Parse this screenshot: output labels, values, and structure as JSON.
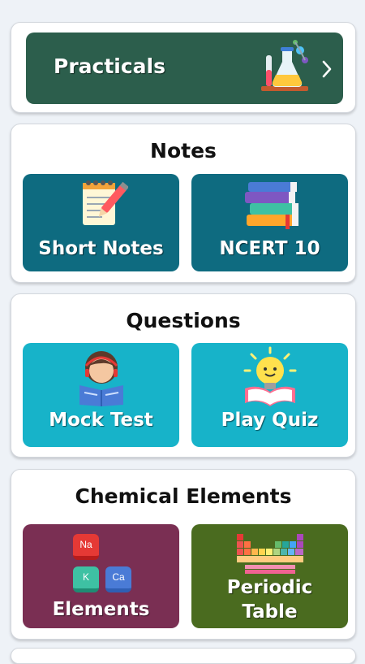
{
  "practicals": {
    "label": "Practicals",
    "icon": "lab-flask-icon",
    "chevron": "chevron-right-icon",
    "color": "#2c5e4c"
  },
  "notes": {
    "title": "Notes",
    "short_notes": {
      "label": "Short Notes",
      "icon": "notepad-pencil-icon",
      "color": "#0e6b80"
    },
    "ncert": {
      "label": "NCERT 10",
      "icon": "book-stack-icon",
      "color": "#0e6b80"
    }
  },
  "questions": {
    "title": "Questions",
    "mock_test": {
      "label": "Mock Test",
      "icon": "student-reading-icon",
      "color": "#17b3c9"
    },
    "play_quiz": {
      "label": "Play Quiz",
      "icon": "lightbulb-book-icon",
      "color": "#17b3c9"
    }
  },
  "chemical_elements": {
    "title": "Chemical Elements",
    "elements": {
      "label": "Elements",
      "icon": "element-blocks-icon",
      "color": "#7a2f53",
      "symbols": [
        "Na",
        "K",
        "Ca"
      ]
    },
    "periodic_table": {
      "label_line1": "Periodic",
      "label_line2": "Table",
      "icon": "periodic-table-icon",
      "color": "#4a6b1f"
    }
  }
}
